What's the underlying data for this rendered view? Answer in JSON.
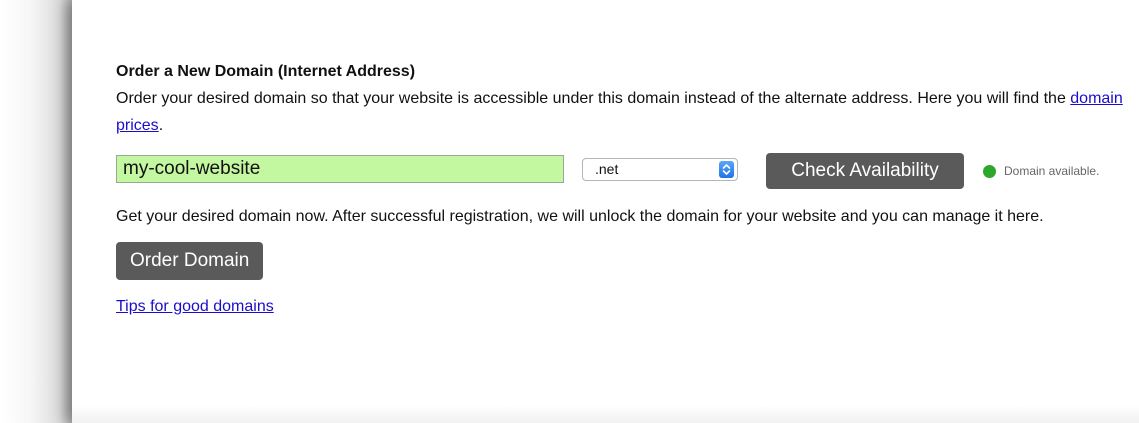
{
  "section": {
    "title": "Order a New Domain (Internet Address)",
    "intro_text": "Order your desired domain so that your website is accessible under this domain instead of the alternate address. Here you will find the ",
    "prices_link": "domain prices",
    "intro_end": "."
  },
  "domain_form": {
    "input_value": "my-cool-website",
    "tld_selected": ".net",
    "check_button": "Check Availability",
    "status_text": "Domain available.",
    "status_color": "#2ea82a",
    "input_background": "#c3f7a0"
  },
  "order": {
    "text": "Get your desired domain now. After successful registration, we will unlock the domain for your website and you can manage it here.",
    "button": "Order Domain"
  },
  "tips_link": "Tips for good domains",
  "icons": {
    "select_arrows": "chevron-up-down-icon",
    "status_dot": "status-dot-icon"
  },
  "colors": {
    "button_background": "#5a5a5a",
    "link": "#1a0dcc"
  }
}
